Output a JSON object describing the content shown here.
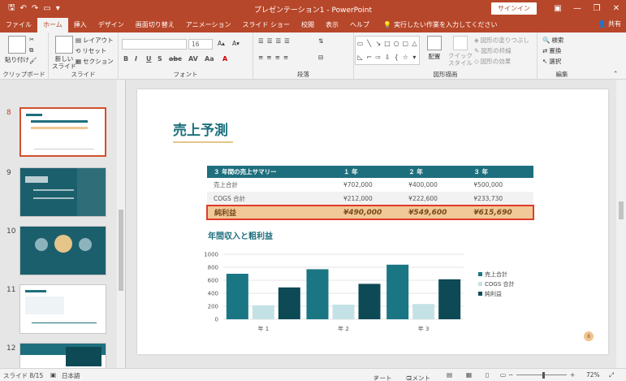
{
  "titlebar": {
    "title": "プレゼンテーション1 - PowerPoint",
    "signin": "サインイン"
  },
  "tabs": [
    {
      "label": "ファイル",
      "active": false
    },
    {
      "label": "ホーム",
      "active": true
    },
    {
      "label": "挿入",
      "active": false
    },
    {
      "label": "デザイン",
      "active": false
    },
    {
      "label": "画面切り替え",
      "active": false
    },
    {
      "label": "アニメーション",
      "active": false
    },
    {
      "label": "スライド ショー",
      "active": false
    },
    {
      "label": "校閲",
      "active": false
    },
    {
      "label": "表示",
      "active": false
    },
    {
      "label": "ヘルプ",
      "active": false
    }
  ],
  "tellme": "実行したい作業を入力してください",
  "share": "共有",
  "ribbon": {
    "clipboard": {
      "paste": "貼り付け",
      "label": "クリップボード"
    },
    "slides": {
      "new": "新しい\nスライド",
      "layout": "レイアウト",
      "reset": "リセット",
      "section": "セクション",
      "label": "スライド"
    },
    "font": {
      "size": "16",
      "label": "フォント"
    },
    "paragraph": {
      "label": "段落"
    },
    "drawing": {
      "arrange": "配置",
      "quickstyle": "クイック\nスタイル",
      "fill": "図形の塗りつぶし",
      "outline": "図形の枠線",
      "effect": "図形の効果",
      "label": "図形描画"
    },
    "editing": {
      "find": "検索",
      "replace": "置換",
      "select": "選択",
      "label": "編集"
    }
  },
  "slides_panel": {
    "items": [
      {
        "num": "8",
        "active": true
      },
      {
        "num": "9",
        "active": false
      },
      {
        "num": "10",
        "active": false
      },
      {
        "num": "11",
        "active": false
      },
      {
        "num": "12",
        "active": false
      }
    ]
  },
  "slide": {
    "title": "売上予測",
    "table": {
      "headers": [
        "３ 年間の売上サマリー",
        "１ 年",
        "２ 年",
        "３ 年"
      ],
      "rows": [
        [
          "売上合計",
          "¥702,000",
          "¥400,000",
          "¥500,000"
        ],
        [
          "COGS 合計",
          "¥212,000",
          "¥222,600",
          "¥233,730"
        ],
        [
          "純利益",
          "¥490,000",
          "¥549,600",
          "¥615,690"
        ]
      ]
    },
    "chart_title": "年間収入と粗利益",
    "page_number": "8"
  },
  "chart_data": {
    "type": "bar",
    "title": "年間収入と粗利益",
    "categories": [
      "年 1",
      "年 2",
      "年 3"
    ],
    "series": [
      {
        "name": "売上合計",
        "values": [
          700,
          770,
          840
        ],
        "color": "#1b7684"
      },
      {
        "name": "COGS 合計",
        "values": [
          215,
          225,
          235
        ],
        "color": "#c4e2e6"
      },
      {
        "name": "純利益",
        "values": [
          490,
          545,
          615
        ],
        "color": "#0d4a56"
      }
    ],
    "yticks": [
      "0",
      "200",
      "400",
      "600",
      "800",
      "1000"
    ],
    "ylim": [
      0,
      1000
    ],
    "grid": true,
    "legend": "right"
  },
  "statusbar": {
    "slide": "スライド 8/15",
    "language": "日本語",
    "notes": "ノート",
    "comments": "コメント",
    "zoom": "72%"
  }
}
